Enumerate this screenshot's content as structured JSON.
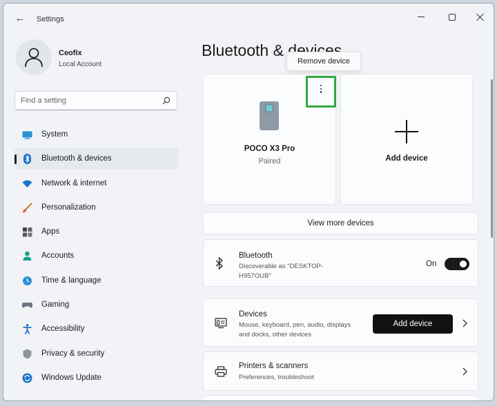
{
  "window": {
    "title": "Settings"
  },
  "profile": {
    "name": "Ceofix",
    "account_type": "Local Account"
  },
  "search": {
    "placeholder": "Find a setting"
  },
  "sidebar": {
    "items": [
      {
        "label": "System",
        "icon": "monitor-icon"
      },
      {
        "label": "Bluetooth & devices",
        "icon": "bluetooth-icon",
        "active": true
      },
      {
        "label": "Network & internet",
        "icon": "wifi-icon"
      },
      {
        "label": "Personalization",
        "icon": "brush-icon"
      },
      {
        "label": "Apps",
        "icon": "apps-icon"
      },
      {
        "label": "Accounts",
        "icon": "person-icon"
      },
      {
        "label": "Time & language",
        "icon": "globe-clock-icon"
      },
      {
        "label": "Gaming",
        "icon": "gamepad-icon"
      },
      {
        "label": "Accessibility",
        "icon": "accessibility-icon"
      },
      {
        "label": "Privacy & security",
        "icon": "shield-icon"
      },
      {
        "label": "Windows Update",
        "icon": "update-icon"
      }
    ]
  },
  "main": {
    "title": "Bluetooth & devices",
    "tooltip": "Remove device",
    "device": {
      "name": "POCO X3 Pro",
      "status": "Paired",
      "icon": "phone-device-icon"
    },
    "add_device_card": {
      "label": "Add device"
    },
    "view_more": "View more devices",
    "bluetooth": {
      "title": "Bluetooth",
      "desc": "Discoverable as \"DESKTOP-H957OUB\"",
      "state": "On"
    },
    "devices": {
      "title": "Devices",
      "desc": "Mouse, keyboard, pen, audio, displays and docks, other devices",
      "button": "Add device"
    },
    "printers": {
      "title": "Printers & scanners",
      "desc": "Preferences, troubleshoot"
    }
  },
  "colors": {
    "accent": "#0067c0",
    "highlight_border": "#2fa83e",
    "toggle_on": "#1b1b1b",
    "window_bg": "#f1f3f6"
  }
}
